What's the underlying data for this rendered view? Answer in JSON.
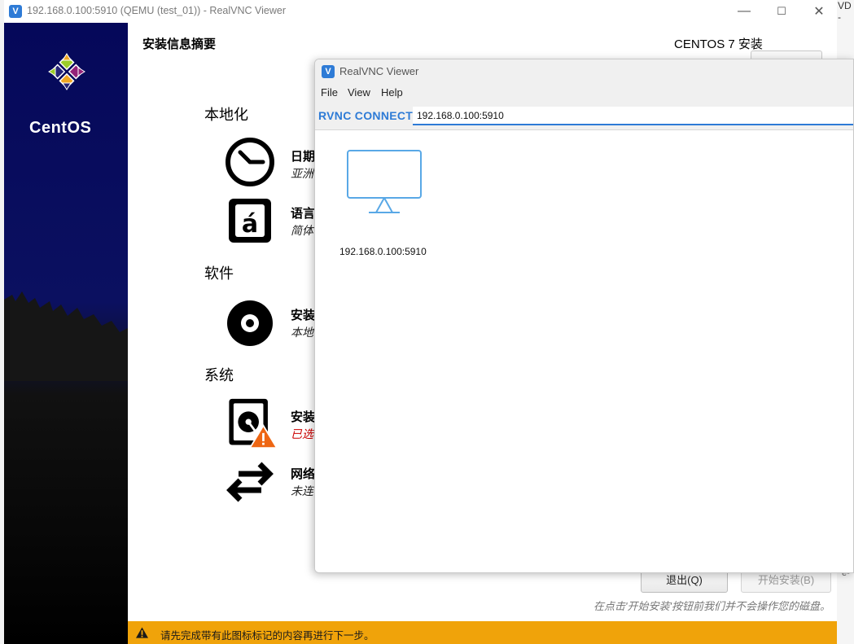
{
  "outer_window": {
    "title": "192.168.0.100:5910 (QEMU (test_01)) - RealVNC Viewer",
    "controls": {
      "minimize": "—",
      "maximize": "☐",
      "close": "✕"
    }
  },
  "desktop_edges": {
    "right_top_text": "VD -",
    "right_bottom_text": "e-"
  },
  "installer": {
    "brand": "CentOS",
    "page_title": "安装信息摘要",
    "product_title": "CENTOS 7 安装",
    "sections": [
      {
        "title": "本地化"
      },
      {
        "title": "软件"
      },
      {
        "title": "系统"
      }
    ],
    "spokes": [
      {
        "title": "日期",
        "status": "亚洲"
      },
      {
        "title": "语言",
        "status": "简体"
      },
      {
        "title": "安装",
        "status": "本地"
      },
      {
        "title": "安装",
        "status": "已选"
      },
      {
        "title": "网络",
        "status": "未连"
      }
    ],
    "quit_button": "退出(Q)",
    "begin_button": "开始安装(B)",
    "hint": "在点击'开始安装'按钮前我们并不会操作您的磁盘。",
    "warning": "请先完成带有此图标标记的内容再进行下一步。"
  },
  "vnc_viewer": {
    "title": "RealVNC Viewer",
    "menu": [
      "File",
      "View",
      "Help"
    ],
    "brand": "RVNC CONNECT",
    "address_value": "192.168.0.100:5910",
    "connections": [
      {
        "label": "192.168.0.100:5910"
      }
    ],
    "accent_color": "#2e7bd6"
  }
}
